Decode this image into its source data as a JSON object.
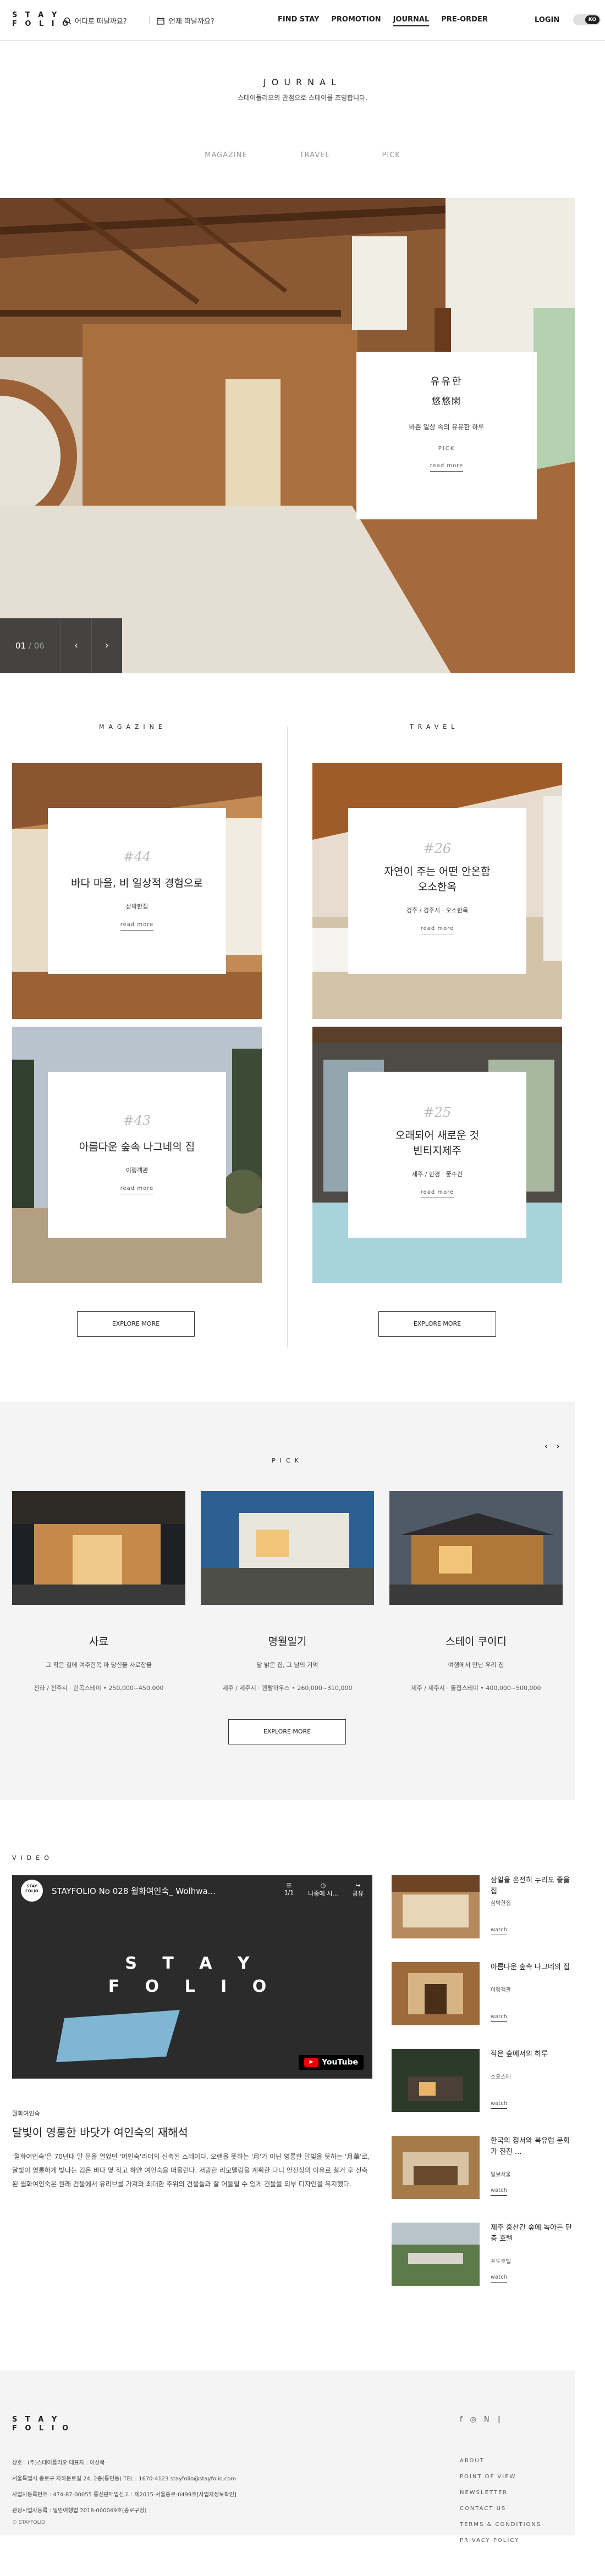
{
  "header": {
    "logo_line1": "S T A Y",
    "logo_line2": "F O L I O",
    "search_label": "어디로 떠날까요?",
    "date_label": "언제 떠날까요?",
    "nav": [
      "FIND STAY",
      "PROMOTION",
      "JOURNAL",
      "PRE-ORDER"
    ],
    "login": "LOGIN",
    "lang": "KO"
  },
  "page": {
    "title": "JOURNAL",
    "subtitle": "스테이폴리오의 관점으로 스테이를 조명합니다.",
    "tabs": [
      "MAGAZINE",
      "TRAVEL",
      "PICK"
    ]
  },
  "hero": {
    "title_ko": "유유한",
    "title_hanja": "悠悠閑",
    "description": "바쁜 일상 속의 유유한 하루",
    "tag": "PICK",
    "read_more": "read more",
    "slide_current": "01",
    "slide_total": "/ 06",
    "prev": "‹",
    "next": "›"
  },
  "magazine": {
    "label": "MAGAZINE",
    "cards": [
      {
        "num": "#44",
        "title": "바다 마을, 비 일상적 경험으로",
        "location": "삼박한집",
        "read_more": "read more"
      },
      {
        "num": "#43",
        "title": "아름다운 숲속 나그네의 집",
        "location": "이링객관",
        "read_more": "read more"
      }
    ],
    "explore": "EXPLORE MORE"
  },
  "travel": {
    "label": "TRAVEL",
    "cards": [
      {
        "num": "#26",
        "title_line1": "자연이 주는 어떤 안온함",
        "title_line2": "오소한옥",
        "location": "경주 / 경주시 · 오소한옥",
        "read_more": "read more"
      },
      {
        "num": "#25",
        "title_line1": "오래되어 새로운 것",
        "title_line2": "빈티지제주",
        "location": "제주 / 한경 · 좋수건",
        "read_more": "read more"
      }
    ],
    "explore": "EXPLORE MORE"
  },
  "pick": {
    "label": "PICK",
    "prev": "‹",
    "next": "›",
    "items": [
      {
        "title": "사료",
        "desc": "그 작은 길에 여주한옥 마 당신을 사로잡을",
        "meta": "전라 / 전주시 · 한옥스테이 • 250,000~450,000"
      },
      {
        "title": "명월일기",
        "desc": "달 밝은 집, 그 날의 기억",
        "meta": "제주 / 제주시 · 펜탈하우스 • 260,000~310,000"
      },
      {
        "title": "스테이 쿠이디",
        "desc": "여행에서 만난 우리 집",
        "meta": "제주 / 제주시 · 돌집스테이 • 400,000~500,000"
      }
    ],
    "explore": "EXPLORE MORE"
  },
  "video": {
    "label": "VIDEO",
    "player": {
      "channel": "STAY FOLIO",
      "title": "STAYFOLIO No 028 월화여인숙_ Wolhwa...",
      "watch_later_count": "1/1",
      "watch_later": "나중에 시...",
      "share": "공유",
      "logo_line1": "S T A Y",
      "logo_line2": "F O L I O",
      "youtube": "YouTube"
    },
    "category": "월화여인숙",
    "title": "달빛이 영롱한 바닷가 여인숙의 재해석",
    "body": "'월화여인숙'은 70년대 말 문을 열었던 '여인숙'라더의 신축된 스테이다. 오랜을 뜻하는 '月'가 아닌 영롱한 달빛을 뜻하는 '月華'로, 달빛이 영롱하게 빛나는 검은 바다 옆 작고 하얀 여인숙을 떠올린다. 저광한 리모델링을 계획한 다니 안전상의 이유로 철거 후 신축된 월화여인숙은 원래 건물에서 유리브를 가져와 최대한 주위의 건물들과 잘 어울릴 수 있게 건물을 외부 디자인을 유지했다.",
    "side": [
      {
        "title": "삼일을 온전히 누리도 좋을 집",
        "location": "삼박한집",
        "watch": "watch"
      },
      {
        "title": "아름다운 숲속 나그네의 집",
        "location": "이링객관",
        "watch": "watch"
      },
      {
        "title": "작은 숲에서의 하루",
        "location": "소요스테",
        "watch": "watch"
      },
      {
        "title": "한국의 정서와 북유럽 문화가 진진 ...",
        "location": "달보서울",
        "watch": "watch"
      },
      {
        "title": "제주 중산간 숲에 녹아든 단층 호텔",
        "location": "포도호텔",
        "watch": "watch"
      }
    ]
  },
  "footer": {
    "logo_line1": "S T A Y",
    "logo_line2": "F O L I O",
    "info": [
      "상호 : (주)스테이폴리오    대표자 : 이상묵",
      "서울특별시 종로구 자하문로길 24, 2층(통인동)    TEL : 1670-4123    stayfolio@stayfolio.com",
      "사업자등록번호 : 474-87-00055    통신판매업신고 : 제2015-서울종로-0499호[사업자정보확인]",
      "관광사업자등록 : 일반여행업 2018-000049호(종로구청)"
    ],
    "copyright": "© STAYFOLIO",
    "social": [
      "f",
      "◎",
      "N",
      "∥"
    ],
    "links": [
      "ABOUT",
      "POINT OF VIEW",
      "NEWSLETTER",
      "CONTACT US",
      "TERMS & CONDITIONS",
      "PRIVACY POLICY"
    ]
  }
}
